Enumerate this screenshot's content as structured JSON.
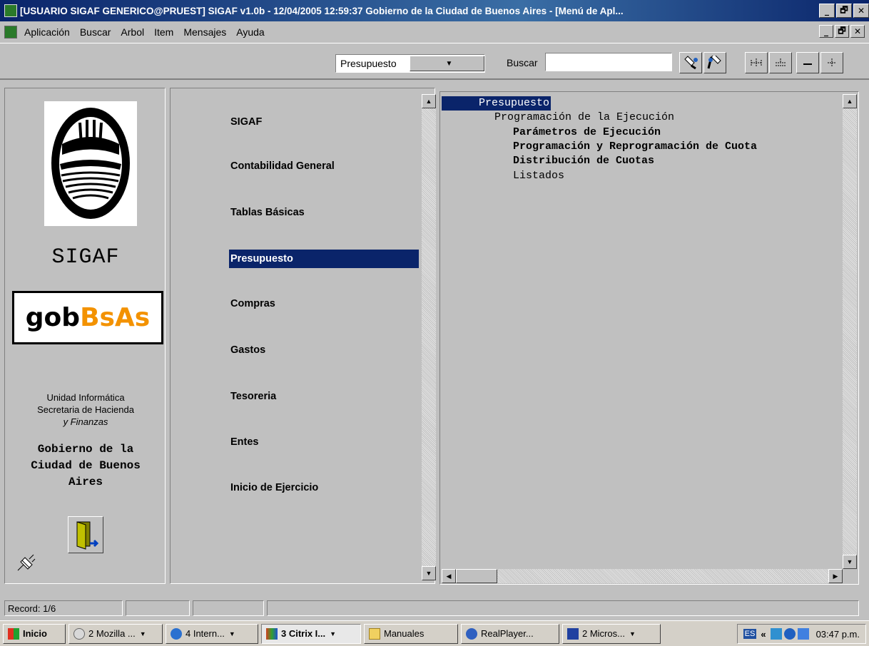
{
  "window": {
    "title": "[USUARIO SIGAF GENERICO@PRUEST]  SIGAF v1.0b - 12/04/2005 12:59:37 Gobierno de la Ciudad de Buenos Aires - [Menú de Apl...",
    "controls": [
      "_",
      "🗗",
      "✕"
    ]
  },
  "menubar": {
    "items": [
      "Aplicación",
      "Buscar",
      "Arbol",
      "Item",
      "Mensajes",
      "Ayuda"
    ],
    "mdi_controls": [
      "_",
      "🗗",
      "✕"
    ]
  },
  "toolbar": {
    "module_select": "Presupuesto",
    "search_label": "Buscar",
    "search_value": ""
  },
  "left": {
    "app_name": "SIGAF",
    "gob_logo_a": "gob",
    "gob_logo_b": "BsAs",
    "unit_line1": "Unidad Informática",
    "unit_line2": "Secretaria de Hacienda",
    "unit_line3": "y Finanzas",
    "gov_line1": "Gobierno de la",
    "gov_line2": "Ciudad de Buenos",
    "gov_line3": "Aires"
  },
  "menu": {
    "items": [
      "SIGAF",
      "Contabilidad General",
      "Tablas Básicas",
      "Presupuesto",
      "Compras",
      "Gastos",
      "Tesoreria",
      "Entes",
      "Inicio de Ejercicio"
    ],
    "selected": "Presupuesto"
  },
  "tree": {
    "nodes": [
      {
        "label": "Presupuesto",
        "level": 0,
        "selected": true,
        "bold": false
      },
      {
        "label": "Programación de la Ejecución",
        "level": 1,
        "selected": false,
        "bold": false
      },
      {
        "label": "Parámetros de Ejecución",
        "level": 2,
        "selected": false,
        "bold": true
      },
      {
        "label": "Programación y Reprogramación de Cuota",
        "level": 2,
        "selected": false,
        "bold": true
      },
      {
        "label": "Distribución de Cuotas",
        "level": 2,
        "selected": false,
        "bold": true
      },
      {
        "label": "Listados",
        "level": 2,
        "selected": false,
        "bold": false
      }
    ]
  },
  "status": {
    "record": "Record: 1/6"
  },
  "taskbar": {
    "start": "Inicio",
    "tasks": [
      "2 Mozilla ...",
      "4 Intern...",
      "3 Citrix I...",
      "Manuales",
      "RealPlayer...",
      "2 Micros..."
    ],
    "tray_lang": "ES",
    "tray_chevron": "«",
    "clock": "03:47 p.m."
  },
  "colors": {
    "selection": "#0a246a",
    "face": "#c0c0c0",
    "gob_orange": "#f39200"
  }
}
